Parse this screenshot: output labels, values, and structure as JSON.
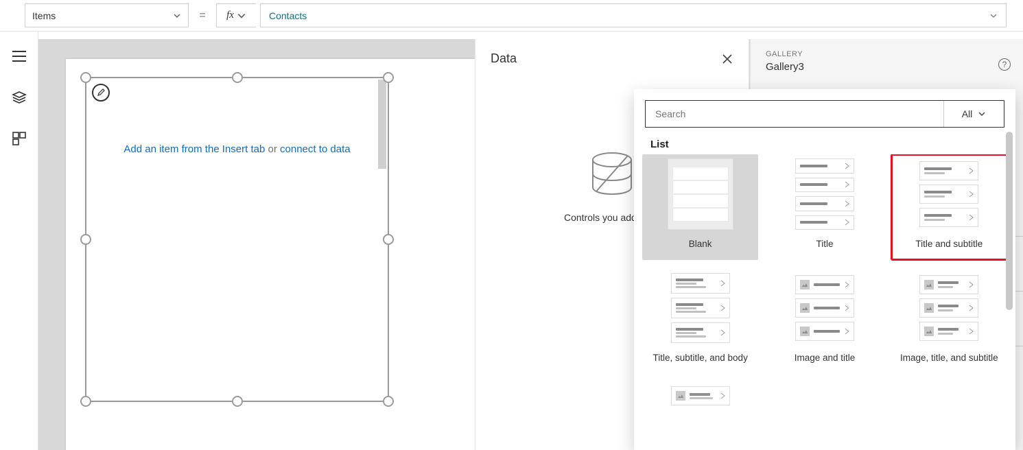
{
  "formulaBar": {
    "property": "Items",
    "value": "Contacts"
  },
  "canvas": {
    "hint_insert": "Add an item from the Insert tab",
    "hint_or": " or ",
    "hint_connect": "connect to data"
  },
  "dataPanel": {
    "title": "Data",
    "empty": "Controls you add will s"
  },
  "propsPanel": {
    "label": "GALLERY",
    "name": "Gallery3"
  },
  "popover": {
    "searchPlaceholder": "Search",
    "filterAll": "All",
    "section": "List",
    "layouts": [
      {
        "id": "blank",
        "label": "Blank"
      },
      {
        "id": "title",
        "label": "Title"
      },
      {
        "id": "title-subtitle",
        "label": "Title and subtitle"
      },
      {
        "id": "tsb",
        "label": "Title, subtitle, and body"
      },
      {
        "id": "image-title",
        "label": "Image and title"
      },
      {
        "id": "image-title-sub",
        "label": "Image, title, and subtitle"
      }
    ]
  }
}
